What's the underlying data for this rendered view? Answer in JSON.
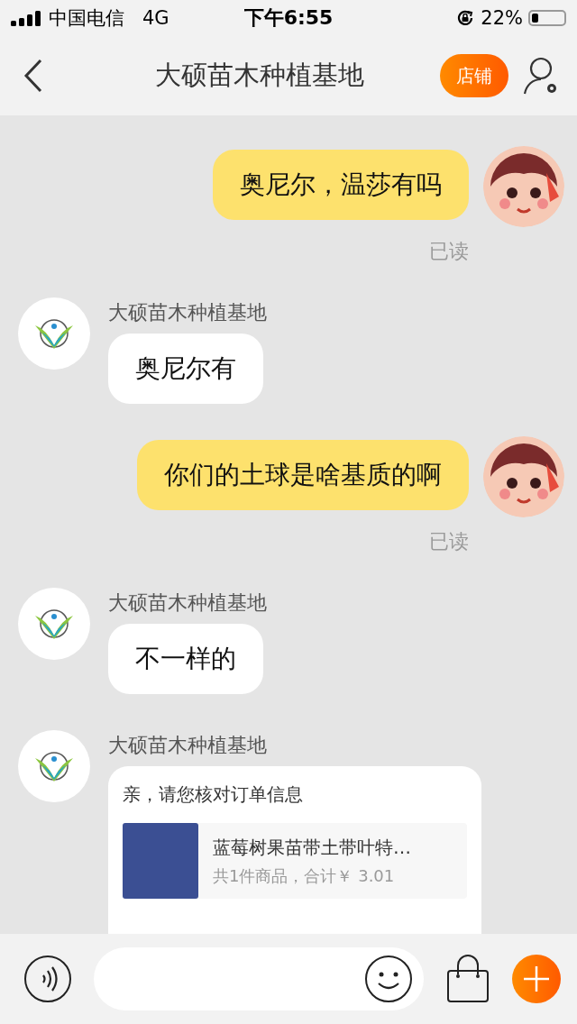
{
  "status_bar": {
    "carrier": "中国电信",
    "network": "4G",
    "time": "下午6:55",
    "battery_percent": "22%",
    "battery": {
      "level": 0.22
    }
  },
  "header": {
    "title": "大硕苗木种植基地",
    "shop_button": "店铺"
  },
  "messages": [
    {
      "kind": "sent",
      "text": "奥尼尔，温莎有吗",
      "receipt": "已读"
    },
    {
      "kind": "received",
      "sender": "大硕苗木种植基地",
      "text": "奥尼尔有"
    },
    {
      "kind": "sent",
      "text": "你们的土球是啥基质的啊",
      "receipt": "已读"
    },
    {
      "kind": "received",
      "sender": "大硕苗木种植基地",
      "text": "不一样的"
    },
    {
      "kind": "order",
      "sender": "大硕苗木种植基地",
      "title": "亲，请您核对订单信息",
      "product": "蓝莓树果苗带土带叶特…",
      "summary": "共1件商品，合计￥ 3.01"
    }
  ]
}
